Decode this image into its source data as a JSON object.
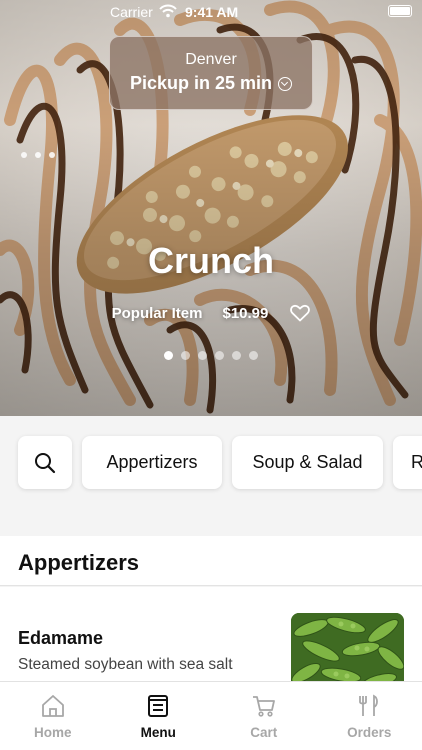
{
  "status_bar": {
    "carrier": "Carrier",
    "time": "9:41 AM"
  },
  "location": {
    "city": "Denver",
    "pickup": "Pickup in 25 min"
  },
  "hero": {
    "title": "Crunch",
    "tag": "Popular Item",
    "price": "$10.99",
    "pages": 6,
    "active_page": 0
  },
  "categories": {
    "items": [
      "Appertizers",
      "Soup & Salad",
      "R"
    ]
  },
  "section": {
    "title": "Appertizers"
  },
  "menu_items": [
    {
      "name": "Edamame",
      "description": "Steamed soybean with sea salt"
    }
  ],
  "tabs": [
    {
      "label": "Home",
      "icon": "home-icon",
      "active": false
    },
    {
      "label": "Menu",
      "icon": "menu-icon",
      "active": true
    },
    {
      "label": "Cart",
      "icon": "cart-icon",
      "active": false
    },
    {
      "label": "Orders",
      "icon": "fork-knife-icon",
      "active": false
    }
  ],
  "colors": {
    "accent": "#111111",
    "inactive": "#a7a7a7",
    "pill": "#8c7364"
  }
}
